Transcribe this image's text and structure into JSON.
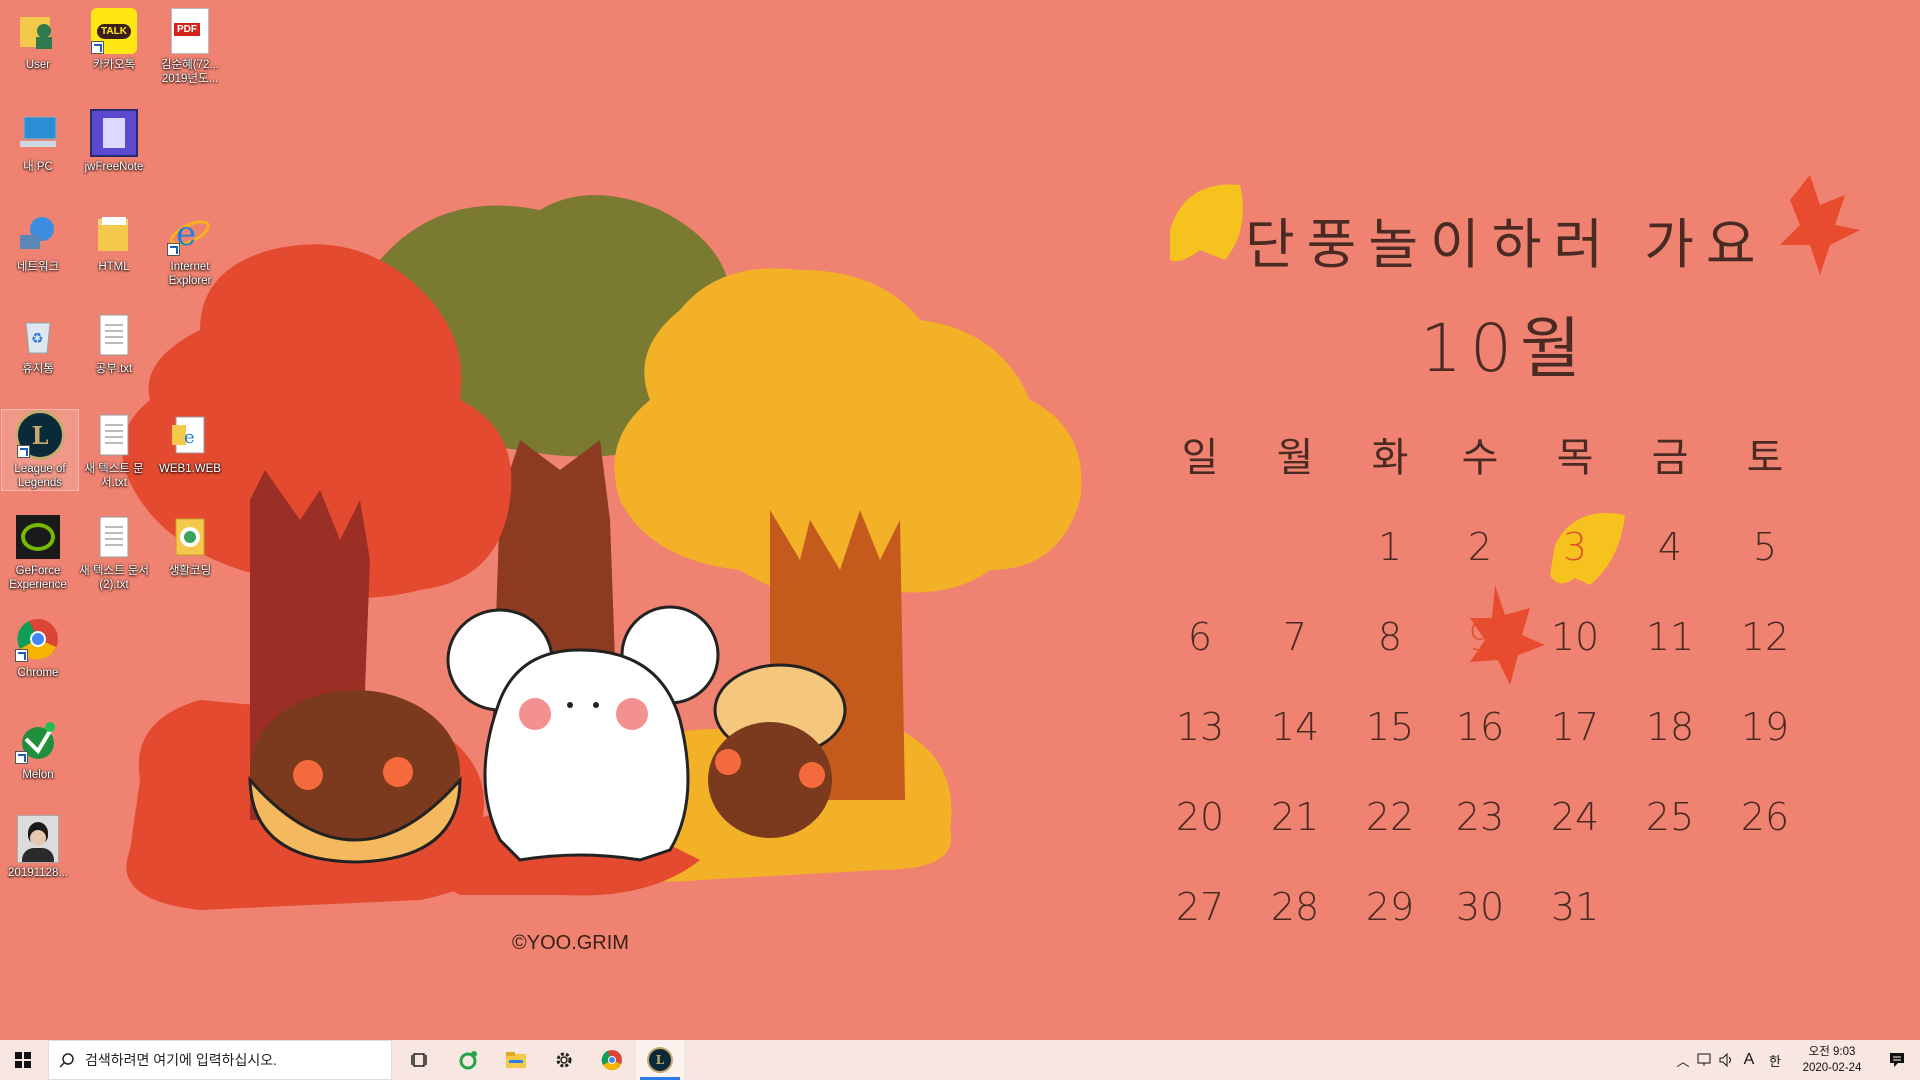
{
  "desktop": {
    "icons": [
      {
        "label": "User"
      },
      {
        "label": "카카오톡",
        "badge": "TALK"
      },
      {
        "label": "김순혜(72... 2019년도...",
        "badge": "PDF"
      },
      {
        "label": "내 PC"
      },
      {
        "label": "jwFreeNote"
      },
      {
        "label": "네트워크"
      },
      {
        "label": "HTML"
      },
      {
        "label": "Internet Explorer"
      },
      {
        "label": "휴지통"
      },
      {
        "label": "공부.txt"
      },
      {
        "label": "League of Legends"
      },
      {
        "label": "새 텍스트 문서.txt"
      },
      {
        "label": "WEB1.WEB"
      },
      {
        "label": "GeForce Experience"
      },
      {
        "label": "새 텍스트 문서 (2).txt"
      },
      {
        "label": "생활코딩"
      },
      {
        "label": "Chrome"
      },
      {
        "label": "Melon"
      },
      {
        "label": "20191128..."
      }
    ]
  },
  "wallpaper": {
    "title": "단풍놀이하러 가요",
    "month": "10월",
    "weekdays": [
      "일",
      "월",
      "화",
      "수",
      "목",
      "금",
      "토"
    ],
    "weeks": [
      [
        "",
        "",
        "",
        "1",
        "2",
        "3",
        "4"
      ],
      [
        "5",
        "6",
        "7",
        "8",
        "9",
        "10",
        "11"
      ]
    ],
    "calendar_rows": [
      [
        "",
        "",
        "1",
        "2",
        "3",
        "4",
        "5"
      ],
      [
        "6",
        "7",
        "8",
        "9",
        "10",
        "11",
        "12"
      ],
      [
        "13",
        "14",
        "15",
        "16",
        "17",
        "18",
        "19"
      ],
      [
        "20",
        "21",
        "22",
        "23",
        "24",
        "25",
        "26"
      ],
      [
        "27",
        "28",
        "29",
        "30",
        "31",
        "",
        ""
      ]
    ],
    "highlighted_days": [
      "3",
      "9"
    ],
    "credit": "©YOO.GRIM",
    "colors": {
      "background": "#ef8270",
      "red_tree": "#e34a2f",
      "olive_tree": "#7a7a30",
      "yellow_tree": "#f2b127"
    }
  },
  "taskbar": {
    "search_placeholder": "검색하려면 여기에 입력하십시오.",
    "apps": [
      "task-view",
      "green-app",
      "file-explorer",
      "settings",
      "chrome",
      "league-of-legends"
    ],
    "tray": {
      "ime_letter": "A",
      "ime_lang": "한"
    },
    "clock": {
      "time": "오전 9:03",
      "date": "2020-02-24"
    }
  }
}
